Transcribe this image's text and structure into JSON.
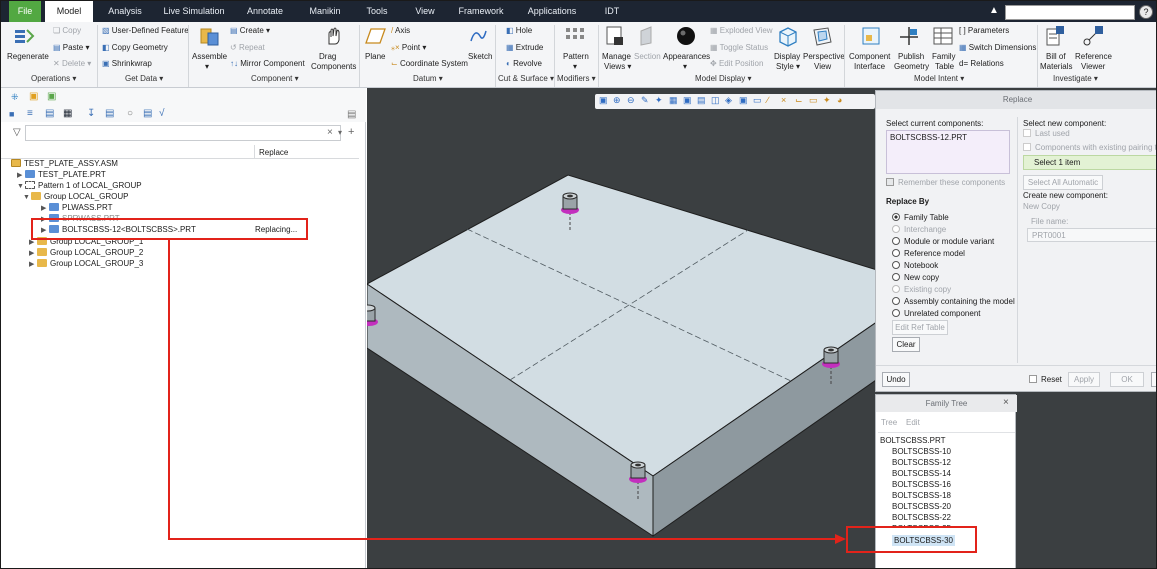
{
  "menu": {
    "file": "File",
    "model": "Model",
    "analysis": "Analysis",
    "live_simulation": "Live Simulation",
    "annotate": "Annotate",
    "manikin": "Manikin",
    "tools": "Tools",
    "view": "View",
    "framework": "Framework",
    "applications": "Applications",
    "idt": "IDT"
  },
  "ribbon": {
    "operations": {
      "regenerate": "Regenerate",
      "copy": "Copy",
      "paste": "Paste",
      "delete": "Delete",
      "label": "Operations"
    },
    "get_data": {
      "user_defined_feature": "User-Defined Feature",
      "copy_geometry": "Copy Geometry",
      "shrinkwrap": "Shrinkwrap",
      "label": "Get Data"
    },
    "component": {
      "assemble": "Assemble",
      "create": "Create",
      "repeat": "Repeat",
      "mirror_component": "Mirror Component",
      "drag_components": "Drag Components",
      "label": "Component"
    },
    "datum": {
      "plane": "Plane",
      "axis": "Axis",
      "point": "Point",
      "coordinate_system": "Coordinate System",
      "sketch": "Sketch",
      "label": "Datum"
    },
    "cut_surface": {
      "hole": "Hole",
      "extrude": "Extrude",
      "revolve": "Revolve",
      "label": "Cut & Surface"
    },
    "modifiers": {
      "pattern": "Pattern",
      "label": "Modifiers"
    },
    "model_display": {
      "manage_views": "Manage Views",
      "section": "Section",
      "appearances": "Appearances",
      "exploded_view": "Exploded View",
      "toggle_status": "Toggle Status",
      "edit_position": "Edit Position",
      "display_style": "Display Style",
      "perspective_view": "Perspective View",
      "label": "Model Display"
    },
    "model_intent": {
      "component_interface": "Component Interface",
      "publish_geometry": "Publish Geometry",
      "family_table": "Family Table",
      "parameters": "Parameters",
      "switch_dimensions": "Switch Dimensions",
      "relations": "Relations",
      "label": "Model Intent"
    },
    "investigate": {
      "bill_of_materials": "Bill of Materials",
      "reference_viewer": "Reference Viewer",
      "label": "Investigate"
    }
  },
  "model_tree": {
    "column_replace": "Replace",
    "items": [
      {
        "label": "TEST_PLATE_ASSY.ASM",
        "value": ""
      },
      {
        "label": "TEST_PLATE.PRT",
        "value": ""
      },
      {
        "label": "Pattern 1 of LOCAL_GROUP",
        "value": ""
      },
      {
        "label": "Group LOCAL_GROUP",
        "value": ""
      },
      {
        "label": "PLWASS.PRT",
        "value": ""
      },
      {
        "label": "SPRWASS.PRT",
        "value": ""
      },
      {
        "label": "BOLTSCBSS-12<BOLTSCBSS>.PRT",
        "value": "Replacing..."
      },
      {
        "label": "Group LOCAL_GROUP_1",
        "value": ""
      },
      {
        "label": "Group LOCAL_GROUP_2",
        "value": ""
      },
      {
        "label": "Group LOCAL_GROUP_3",
        "value": ""
      }
    ]
  },
  "replace_dialog": {
    "title": "Replace",
    "select_current_label": "Select current components:",
    "current_component": "BOLTSCBSS-12.PRT",
    "remember_label": "Remember these components",
    "replace_by_label": "Replace By",
    "options": [
      {
        "label": "Family Table",
        "selected": true,
        "enabled": true
      },
      {
        "label": "Interchange",
        "selected": false,
        "enabled": false
      },
      {
        "label": "Module or module variant",
        "selected": false,
        "enabled": true
      },
      {
        "label": "Reference model",
        "selected": false,
        "enabled": true
      },
      {
        "label": "Notebook",
        "selected": false,
        "enabled": true
      },
      {
        "label": "New copy",
        "selected": false,
        "enabled": true
      },
      {
        "label": "Existing copy",
        "selected": false,
        "enabled": false
      },
      {
        "label": "Assembly containing the model",
        "selected": false,
        "enabled": true
      },
      {
        "label": "Unrelated component",
        "selected": false,
        "enabled": true
      }
    ],
    "edit_ref_table": "Edit Ref Table",
    "clear": "Clear",
    "select_new_label": "Select new component:",
    "last_used": "Last used",
    "existing_pairing": "Components with existing pairing ta",
    "select_item": "Select 1 item",
    "select_all_automatic": "Select All Automatic",
    "create_new_label": "Create new component:",
    "new_copy": "New Copy",
    "file_name_label": "File name:",
    "file_name_value": "PRT0001",
    "undo": "Undo",
    "reset": "Reset",
    "apply": "Apply",
    "ok": "OK"
  },
  "family_tree": {
    "title": "Family Tree",
    "menu_tree": "Tree",
    "menu_edit": "Edit",
    "root": "BOLTSCBSS.PRT",
    "items": [
      "BOLTSCBSS-10",
      "BOLTSCBSS-12",
      "BOLTSCBSS-14",
      "BOLTSCBSS-16",
      "BOLTSCBSS-18",
      "BOLTSCBSS-20",
      "BOLTSCBSS-22",
      "BOLTSCBSS-25",
      "BOLTSCBSS-30"
    ],
    "selected": "BOLTSCBSS-30"
  },
  "colors": {
    "menu_bg": "#1d2532",
    "file_tab": "#52a842",
    "viewport_bg": "#3b3f41",
    "plate_top": "#d2dde3",
    "annotation_red": "#e2231a",
    "selection_blue": "#cfe4f5"
  }
}
